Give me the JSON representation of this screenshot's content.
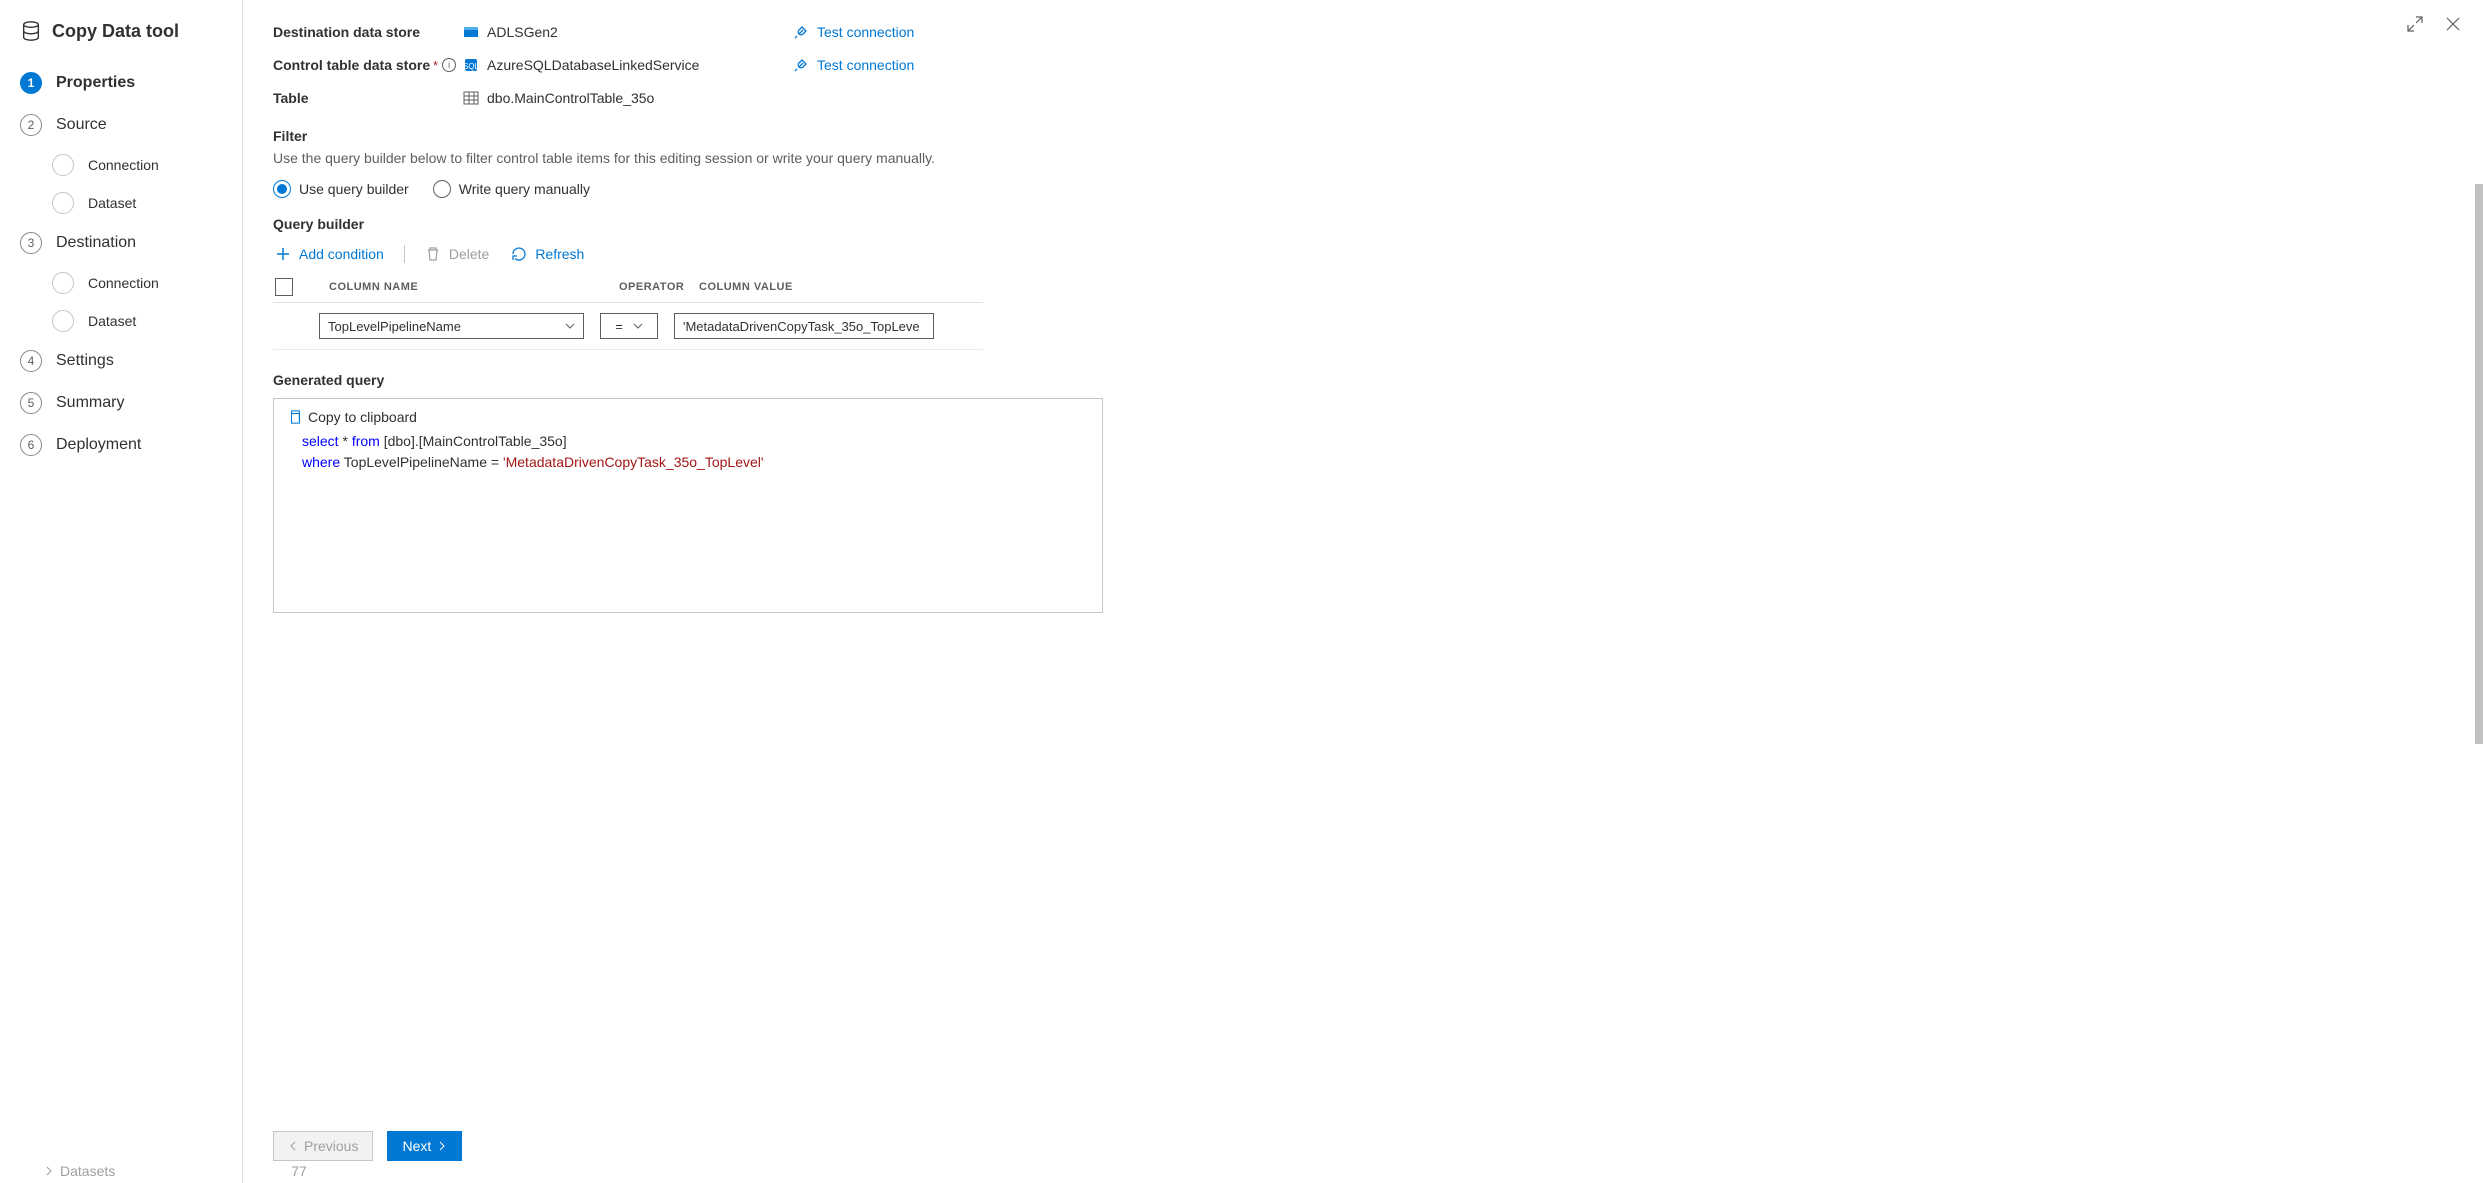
{
  "title": "Copy Data tool",
  "nav": {
    "steps": [
      {
        "num": "1",
        "label": "Properties",
        "active": true
      },
      {
        "num": "2",
        "label": "Source",
        "subs": [
          "Connection",
          "Dataset"
        ]
      },
      {
        "num": "3",
        "label": "Destination",
        "subs": [
          "Connection",
          "Dataset"
        ]
      },
      {
        "num": "4",
        "label": "Settings"
      },
      {
        "num": "5",
        "label": "Summary"
      },
      {
        "num": "6",
        "label": "Deployment"
      }
    ]
  },
  "fields": {
    "dest_label": "Destination data store",
    "dest_value": "ADLSGen2",
    "ctrl_label": "Control table data store",
    "ctrl_value": "AzureSQLDatabaseLinkedService",
    "table_label": "Table",
    "table_value": "dbo.MainControlTable_35o",
    "test_conn": "Test connection"
  },
  "filter": {
    "title": "Filter",
    "desc": "Use the query builder below to filter control table items for this editing session or write your query manually.",
    "radio_builder": "Use query builder",
    "radio_manual": "Write query manually"
  },
  "qb": {
    "title": "Query builder",
    "add": "Add condition",
    "delete": "Delete",
    "refresh": "Refresh",
    "headers": {
      "col": "COLUMN NAME",
      "op": "OPERATOR",
      "val": "COLUMN VALUE"
    },
    "row": {
      "column": "TopLevelPipelineName",
      "operator": "=",
      "value": "'MetadataDrivenCopyTask_35o_TopLeve"
    }
  },
  "gen_query": {
    "title": "Generated query",
    "copy": "Copy to clipboard",
    "sql_select": "select",
    "sql_star": "*",
    "sql_from": "from",
    "sql_table": "[dbo].[MainControlTable_35o]",
    "sql_where": "where",
    "sql_cond_col": "TopLevelPipelineName =",
    "sql_cond_val": "'MetadataDrivenCopyTask_35o_TopLevel'"
  },
  "buttons": {
    "prev": "Previous",
    "next": "Next"
  },
  "tree_hint": {
    "label": "Datasets",
    "count": "77"
  }
}
